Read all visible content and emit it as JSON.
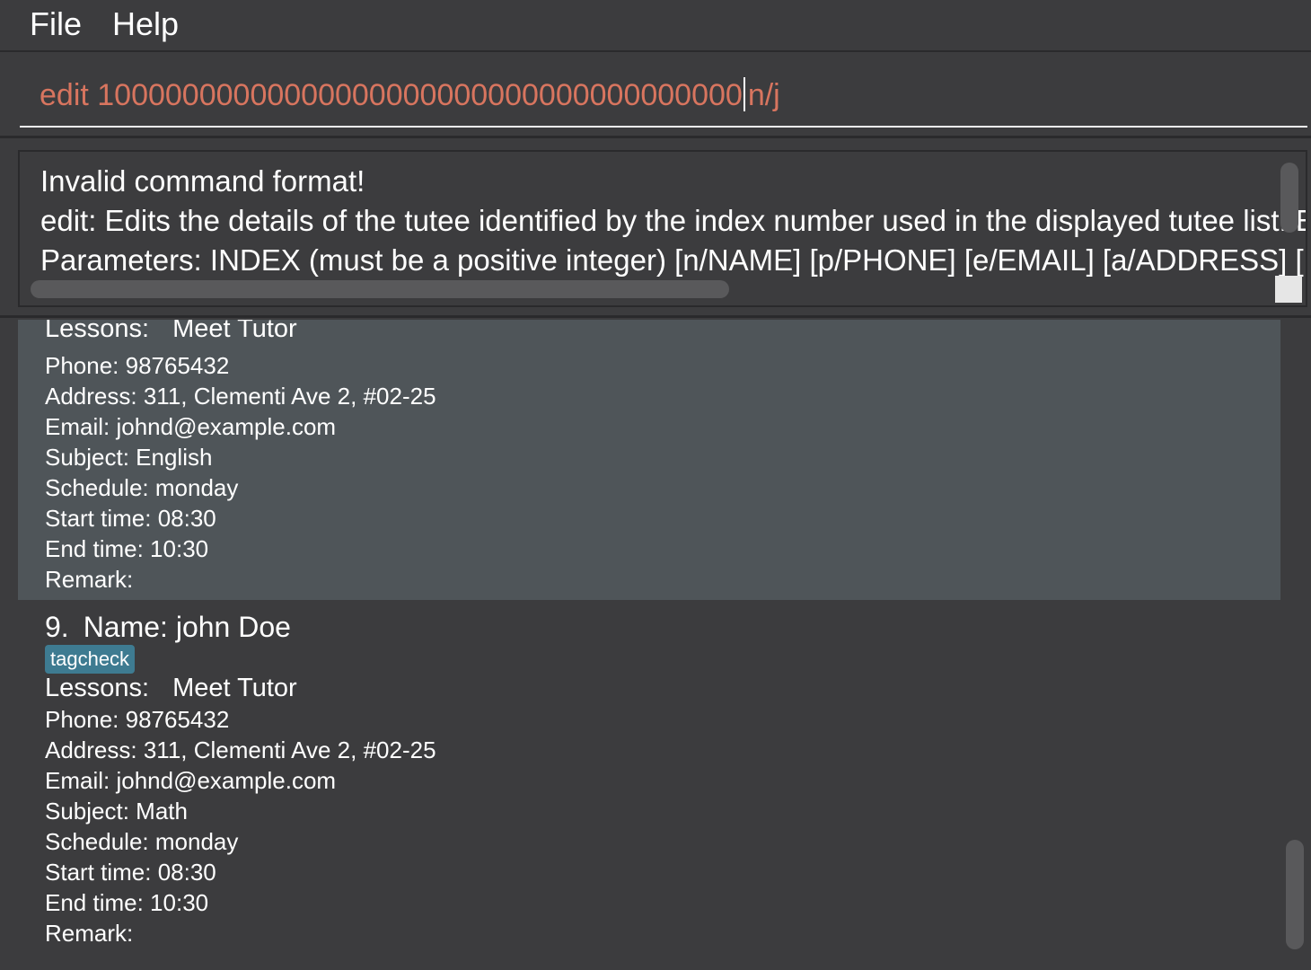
{
  "menu": {
    "file": "File",
    "help": "Help"
  },
  "command": {
    "before_caret": "edit 10000000000000000000000000000000000000",
    "after_caret": "n/j"
  },
  "result": {
    "lines": [
      "Invalid command format!",
      "edit: Edits the details of the tutee identified by the index number used in the displayed tutee list. E",
      "Parameters: INDEX (must be a positive integer) [n/NAME] [p/PHONE] [e/EMAIL] [a/ADDRESS] ["
    ]
  },
  "tutees": [
    {
      "lessons_label": "Lessons:",
      "lessons_value": "Meet Tutor",
      "phone": "Phone: 98765432",
      "address": "Address: 311, Clementi Ave 2, #02-25",
      "email": "Email: johnd@example.com",
      "subject": "Subject: English",
      "schedule": "Schedule: monday",
      "start_time": "Start time: 08:30",
      "end_time": "End time: 10:30",
      "remark": "Remark:"
    },
    {
      "index": "9.",
      "name": "Name: john Doe",
      "tag": "tagcheck",
      "lessons_label": "Lessons:",
      "lessons_value": "Meet Tutor",
      "phone": "Phone: 98765432",
      "address": "Address: 311, Clementi Ave 2, #02-25",
      "email": "Email: johnd@example.com",
      "subject": "Subject: Math",
      "schedule": "Schedule: monday",
      "start_time": "Start time: 08:30",
      "end_time": "End time: 10:30",
      "remark": "Remark:"
    }
  ],
  "colors": {
    "background": "#3c3c3e",
    "command_text": "#d8755f",
    "selected_card": "#4f5559",
    "tag": "#3e7b91"
  }
}
